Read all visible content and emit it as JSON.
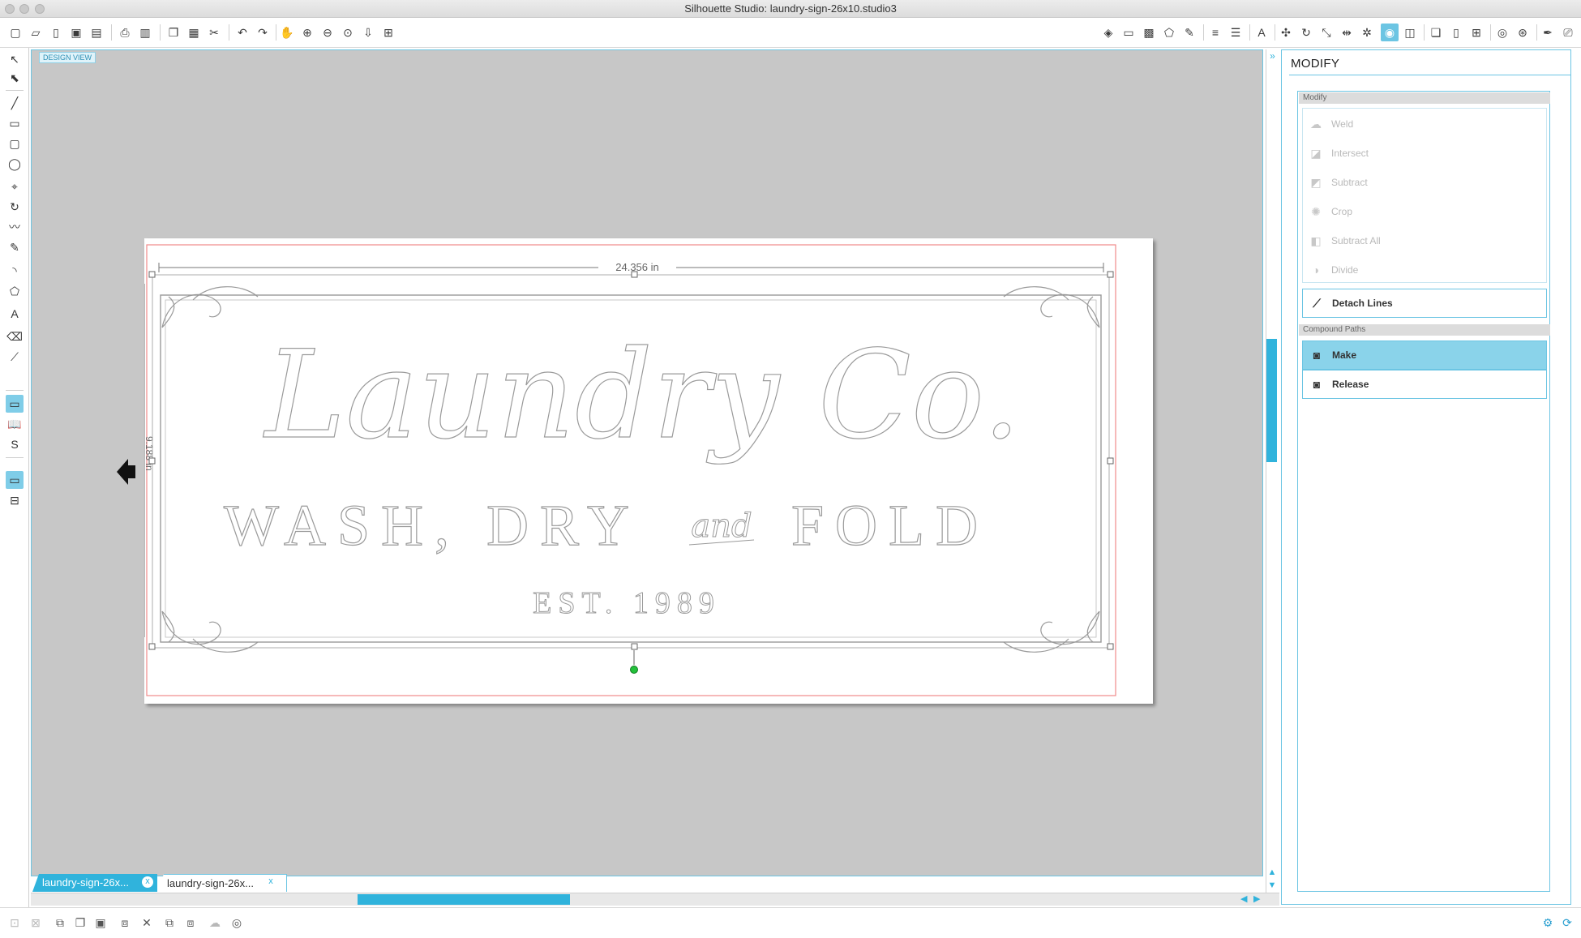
{
  "window": {
    "title": "Silhouette Studio: laundry-sign-26x10.studio3"
  },
  "canvas": {
    "view_label": "DESIGN VIEW",
    "width_dimension": "24.356 in",
    "height_dimension": "9.188 in",
    "design": {
      "line1": "Laundry Co.",
      "line2_left": "WASH, DRY",
      "line2_script": "and",
      "line2_right": "FOLD",
      "line3": "EST. 1989"
    }
  },
  "tabs": [
    {
      "label": "laundry-sign-26x...",
      "close": "x",
      "active": true
    },
    {
      "label": "laundry-sign-26x...",
      "close": "x",
      "active": false
    }
  ],
  "panel": {
    "title": "MODIFY",
    "modify_group": {
      "header": "Modify",
      "items": [
        {
          "label": "Weld",
          "icon": "weld-icon"
        },
        {
          "label": "Intersect",
          "icon": "intersect-icon"
        },
        {
          "label": "Subtract",
          "icon": "subtract-icon"
        },
        {
          "label": "Crop",
          "icon": "crop-icon"
        },
        {
          "label": "Subtract All",
          "icon": "subtract-all-icon"
        },
        {
          "label": "Divide",
          "icon": "divide-icon"
        }
      ],
      "detach_lines": "Detach Lines"
    },
    "compound_group": {
      "header": "Compound Paths",
      "make": "Make",
      "release": "Release"
    }
  },
  "colors": {
    "accent": "#30b3dc",
    "canvas_bg": "#c7c7c7",
    "cut_border": "#f08a8a",
    "selected_button": "#8ad3ea",
    "handle_rotate": "#22c03a"
  }
}
